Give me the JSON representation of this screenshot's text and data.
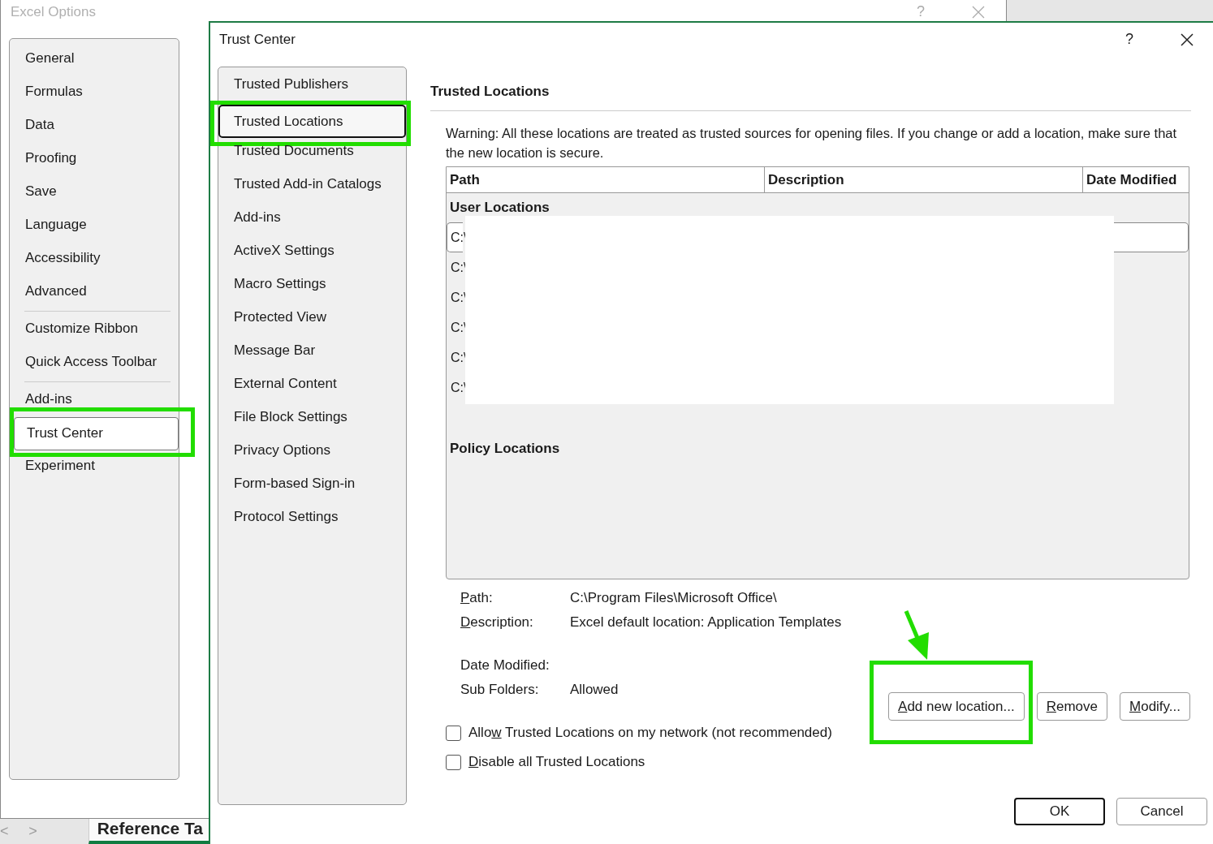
{
  "background_window": {
    "title": "Excel Options",
    "help": "?",
    "nav_groups": [
      [
        {
          "label": "General",
          "selected": false,
          "highlighted": false
        },
        {
          "label": "Formulas",
          "selected": false,
          "highlighted": false
        },
        {
          "label": "Data",
          "selected": false,
          "highlighted": false
        },
        {
          "label": "Proofing",
          "selected": false,
          "highlighted": false
        },
        {
          "label": "Save",
          "selected": false,
          "highlighted": false
        },
        {
          "label": "Language",
          "selected": false,
          "highlighted": false
        },
        {
          "label": "Accessibility",
          "selected": false,
          "highlighted": false
        },
        {
          "label": "Advanced",
          "selected": false,
          "highlighted": false
        }
      ],
      [
        {
          "label": "Customize Ribbon",
          "selected": false,
          "highlighted": false
        },
        {
          "label": "Quick Access Toolbar",
          "selected": false,
          "highlighted": false
        }
      ],
      [
        {
          "label": "Add-ins",
          "selected": false,
          "highlighted": false
        },
        {
          "label": "Trust Center",
          "selected": true,
          "highlighted": true
        },
        {
          "label": "Experiment",
          "selected": false,
          "highlighted": false
        }
      ]
    ],
    "sheet_nav": [
      "<",
      ">"
    ],
    "sheet_tab": "Reference Ta"
  },
  "dialog": {
    "title": "Trust Center",
    "help": "?",
    "nav": [
      {
        "label": "Trusted Publishers",
        "selected": false,
        "highlighted": false
      },
      {
        "label": "Trusted Locations",
        "selected": true,
        "highlighted": true
      },
      {
        "label": "Trusted Documents",
        "selected": false,
        "highlighted": false
      },
      {
        "label": "Trusted Add-in Catalogs",
        "selected": false,
        "highlighted": false
      },
      {
        "label": "Add-ins",
        "selected": false,
        "highlighted": false
      },
      {
        "label": "ActiveX Settings",
        "selected": false,
        "highlighted": false
      },
      {
        "label": "Macro Settings",
        "selected": false,
        "highlighted": false
      },
      {
        "label": "Protected View",
        "selected": false,
        "highlighted": false
      },
      {
        "label": "Message Bar",
        "selected": false,
        "highlighted": false
      },
      {
        "label": "External Content",
        "selected": false,
        "highlighted": false
      },
      {
        "label": "File Block Settings",
        "selected": false,
        "highlighted": false
      },
      {
        "label": "Privacy Options",
        "selected": false,
        "highlighted": false
      },
      {
        "label": "Form-based Sign-in",
        "selected": false,
        "highlighted": false
      },
      {
        "label": "Protocol Settings",
        "selected": false,
        "highlighted": false
      }
    ],
    "heading": "Trusted Locations",
    "warning": "Warning: All these locations are treated as trusted sources for opening files.  If you change or add a location, make sure that the new location is secure.",
    "table": {
      "columns": [
        "Path",
        "Description",
        "Date Modified"
      ],
      "user_group": "User Locations",
      "rows": [
        {
          "path": "C:\\",
          "selected": true
        },
        {
          "path": "C:\\",
          "selected": false
        },
        {
          "path": "C:\\",
          "selected": false
        },
        {
          "path": "C:\\",
          "selected": false
        },
        {
          "path": "C:\\",
          "selected": false
        },
        {
          "path": "C:\\",
          "selected": false
        }
      ],
      "policy_group": "Policy Locations"
    },
    "details": [
      {
        "label": {
          "key": "P",
          "post": "ath:"
        },
        "value": "C:\\Program Files\\Microsoft Office\\"
      },
      {
        "label": {
          "key": "D",
          "post": "escription:"
        },
        "value": "Excel default location: Application Templates"
      },
      {
        "label": {
          "pre": "Date Modified:"
        }
      },
      {
        "label": {
          "pre": "Sub Folders:"
        },
        "value": "Allowed"
      }
    ],
    "buttons": [
      {
        "label": {
          "key": "A",
          "post": "dd new location..."
        },
        "highlighted": true
      },
      {
        "label": {
          "key": "R",
          "post": "emove"
        },
        "highlighted": false
      },
      {
        "label": {
          "key": "M",
          "post": "odify..."
        },
        "highlighted": false
      }
    ],
    "checkboxes": [
      {
        "label": {
          "pre": "Allo",
          "key": "w",
          "post": " Trusted Locations on my network (not recommended)"
        },
        "checked": false
      },
      {
        "label": {
          "key": "D",
          "post": "isable all Trusted Locations"
        },
        "checked": false
      }
    ],
    "footer_buttons": [
      {
        "label": "OK",
        "default": true
      },
      {
        "label": "Cancel",
        "default": false
      }
    ]
  }
}
